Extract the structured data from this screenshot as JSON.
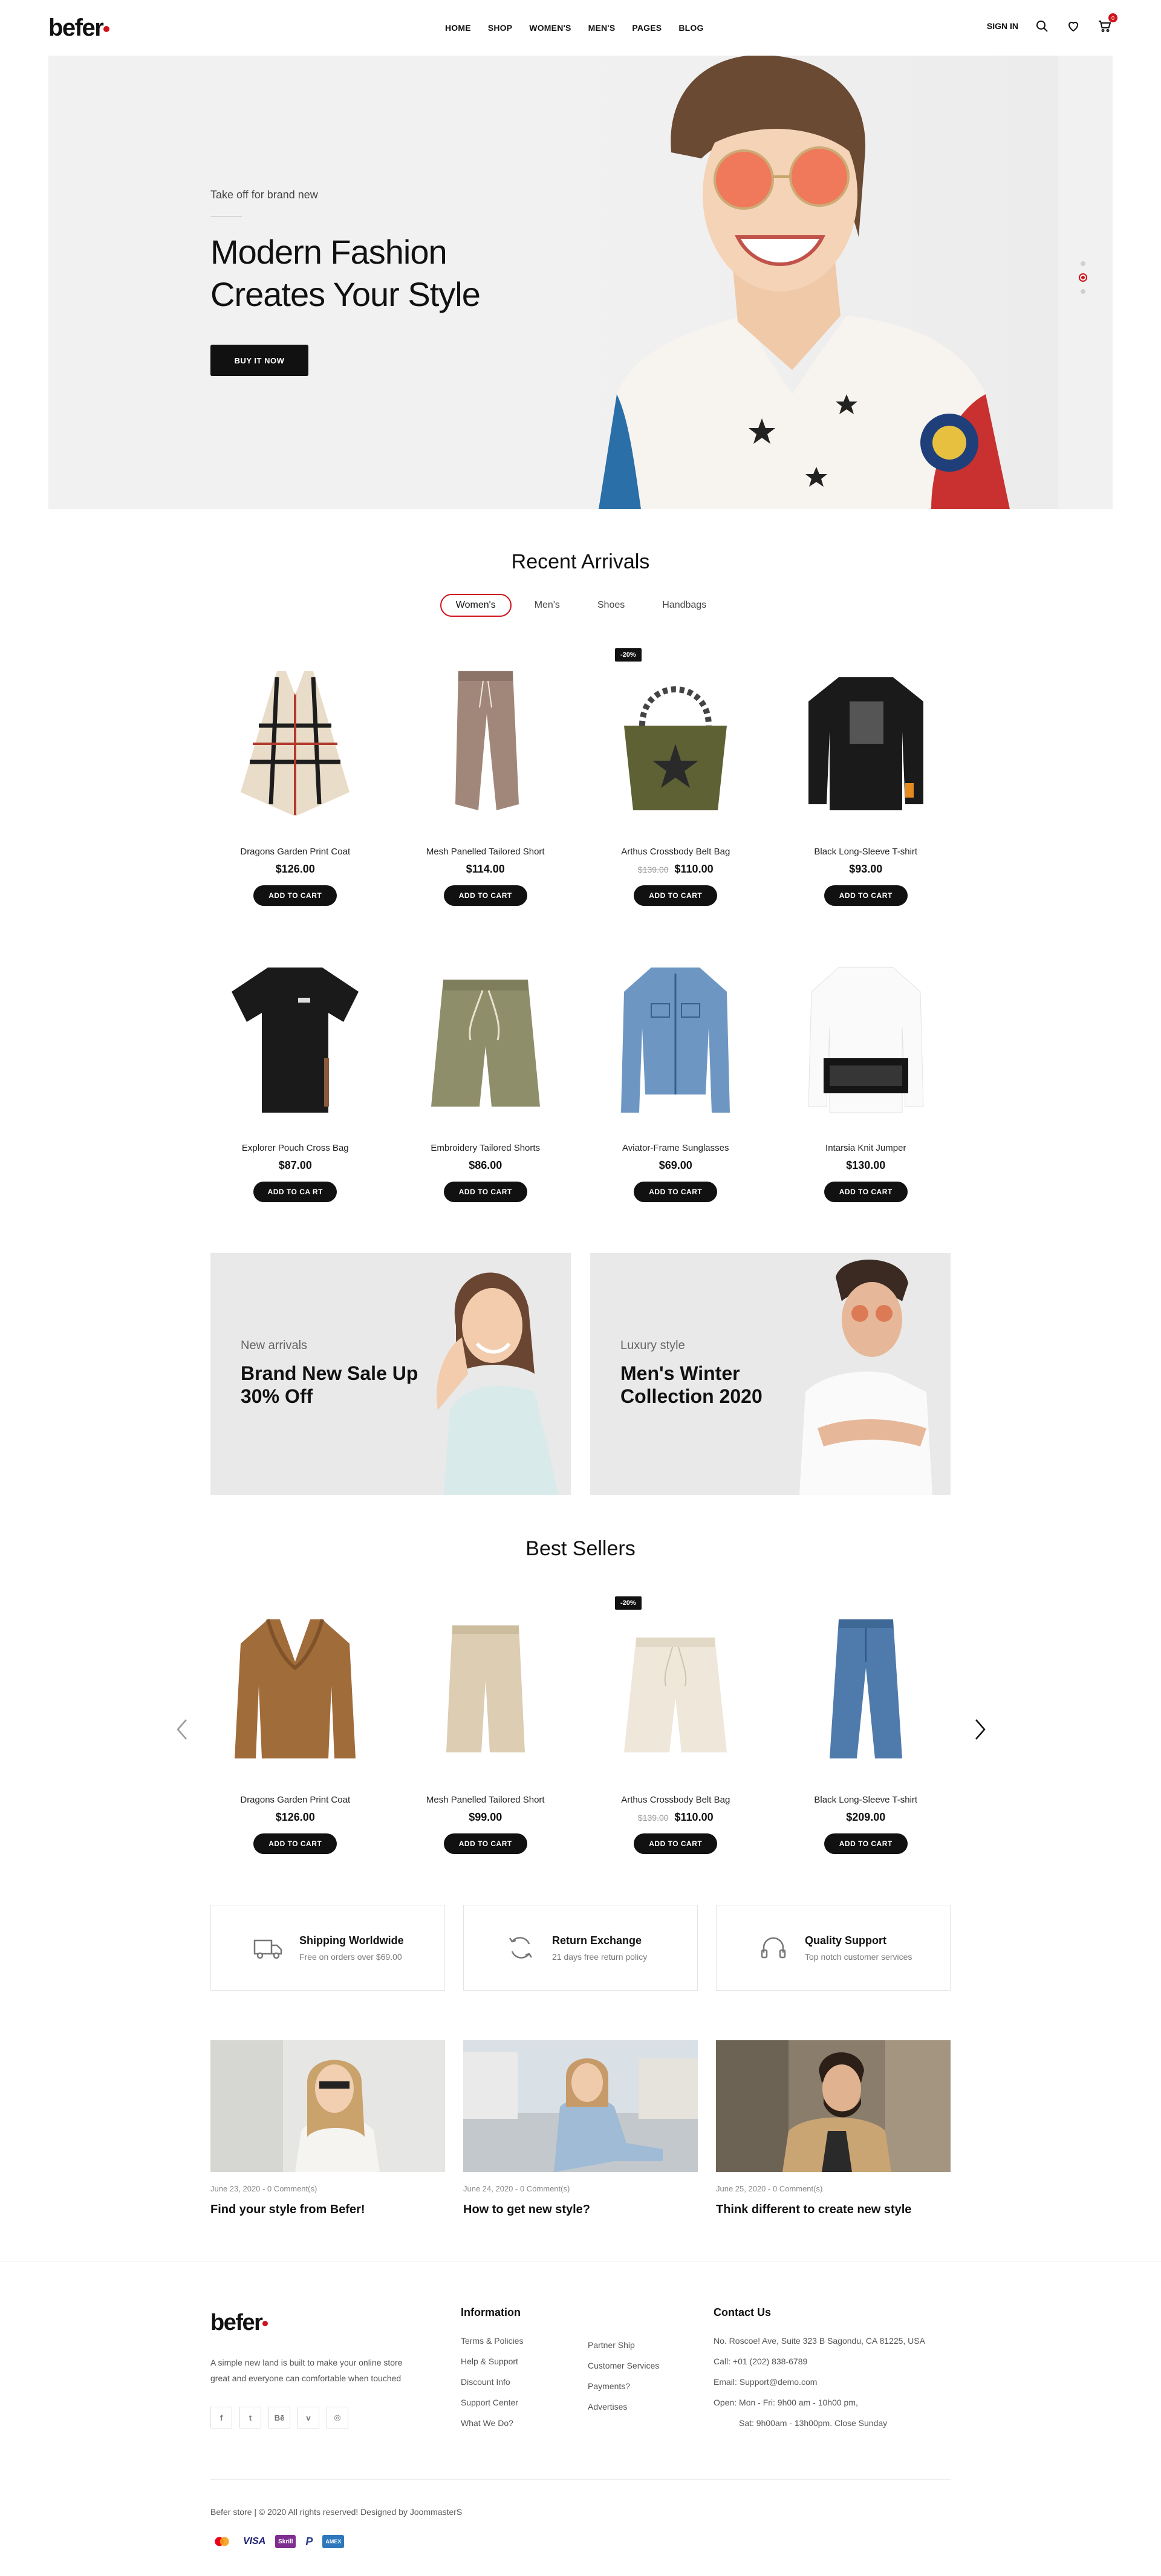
{
  "header": {
    "logo": "befer",
    "nav": [
      "HOME",
      "SHOP",
      "WOMEN'S",
      "MEN'S",
      "PAGES",
      "BLOG"
    ],
    "signin": "SIGN IN",
    "cart_count": "0"
  },
  "hero": {
    "subtitle": "Take off for brand new",
    "title_line1": "Modern Fashion",
    "title_line2": "Creates Your Style",
    "cta": "BUY IT NOW",
    "slide_index": 2,
    "slide_count": 3
  },
  "recent": {
    "title": "Recent Arrivals",
    "tabs": [
      "Women's",
      "Men's",
      "Shoes",
      "Handbags"
    ],
    "active_tab": "Women's",
    "products": [
      {
        "name": "Dragons Garden Print Coat",
        "price": "$126.00",
        "old": "",
        "badge": "",
        "icon": "poncho-image"
      },
      {
        "name": "Mesh Panelled Tailored Short",
        "price": "$114.00",
        "old": "",
        "badge": "",
        "icon": "pants-image"
      },
      {
        "name": "Arthus Crossbody Belt Bag",
        "price": "$110.00",
        "old": "$139.00",
        "badge": "-20%",
        "icon": "bag-image"
      },
      {
        "name": "Black Long-Sleeve T-shirt",
        "price": "$93.00",
        "old": "",
        "badge": "",
        "icon": "sweatshirt-image"
      },
      {
        "name": "Explorer Pouch Cross Bag",
        "price": "$87.00",
        "old": "",
        "badge": "",
        "icon": "tshirt-image"
      },
      {
        "name": "Embroidery Tailored Shorts",
        "price": "$86.00",
        "old": "",
        "badge": "",
        "icon": "shorts-image"
      },
      {
        "name": "Aviator-Frame Sunglasses",
        "price": "$69.00",
        "old": "",
        "badge": "",
        "icon": "jacket-image"
      },
      {
        "name": "Intarsia Knit Jumper",
        "price": "$130.00",
        "old": "",
        "badge": "",
        "icon": "jumper-image"
      }
    ],
    "add_label": "ADD TO CART",
    "add_label_alt": "ADD TO CA RT"
  },
  "banners": [
    {
      "sub": "New arrivals",
      "title": "Brand New Sale Up 30% Off"
    },
    {
      "sub": "Luxury style",
      "title": "Men's Winter Collection 2020"
    }
  ],
  "best": {
    "title": "Best Sellers",
    "products": [
      {
        "name": "Dragons Garden Print Coat",
        "price": "$126.00",
        "old": "",
        "badge": ""
      },
      {
        "name": "Mesh Panelled Tailored Short",
        "price": "$99.00",
        "old": "",
        "badge": ""
      },
      {
        "name": "Arthus Crossbody Belt Bag",
        "price": "$110.00",
        "old": "$139.00",
        "badge": "-20%"
      },
      {
        "name": "Black Long-Sleeve T-shirt",
        "price": "$209.00",
        "old": "",
        "badge": ""
      }
    ]
  },
  "features": [
    {
      "title": "Shipping Worldwide",
      "desc": "Free on orders over $69.00",
      "icon": "truck-icon"
    },
    {
      "title": "Return Exchange",
      "desc": "21 days free return policy",
      "icon": "refresh-icon"
    },
    {
      "title": "Quality Support",
      "desc": "Top notch customer services",
      "icon": "headphones-icon"
    }
  ],
  "blog": [
    {
      "meta": "June 23, 2020 - 0 Comment(s)",
      "title": "Find your style from Befer!"
    },
    {
      "meta": "June 24, 2020 - 0 Comment(s)",
      "title": "How to get new style?"
    },
    {
      "meta": "June 25, 2020 - 0 Comment(s)",
      "title": "Think different to create new style"
    }
  ],
  "footer": {
    "logo": "befer",
    "desc": "A simple new land is built to make your online store great and everyone can comfortable when touched",
    "socials": [
      "f",
      "t",
      "Bē",
      "v",
      "◎"
    ],
    "info_title": "Information",
    "info_col1": [
      "Terms & Policies",
      "Help & Support",
      "Discount Info",
      "Support Center",
      "What We Do?"
    ],
    "info_col2": [
      "Partner Ship",
      "Customer Services",
      "Payments?",
      "Advertises"
    ],
    "contact_title": "Contact Us",
    "contact": [
      "No. Roscoe! Ave, Suite 323 B Sagondu, CA 81225, USA",
      "Call: +01 (202) 838-6789",
      "Email: Support@demo.com",
      "Open: Mon - Fri: 9h00 am - 10h00 pm,",
      "Sat: 9h00am - 13h00pm. Close Sunday"
    ],
    "copyright": "Befer store | © 2020 All rights reserved! Designed by JoommasterS",
    "payments": [
      "MC",
      "VISA",
      "Skrill",
      "P",
      "AMEX"
    ]
  },
  "colors": {
    "accent": "#d0121c",
    "dark": "#111111"
  }
}
